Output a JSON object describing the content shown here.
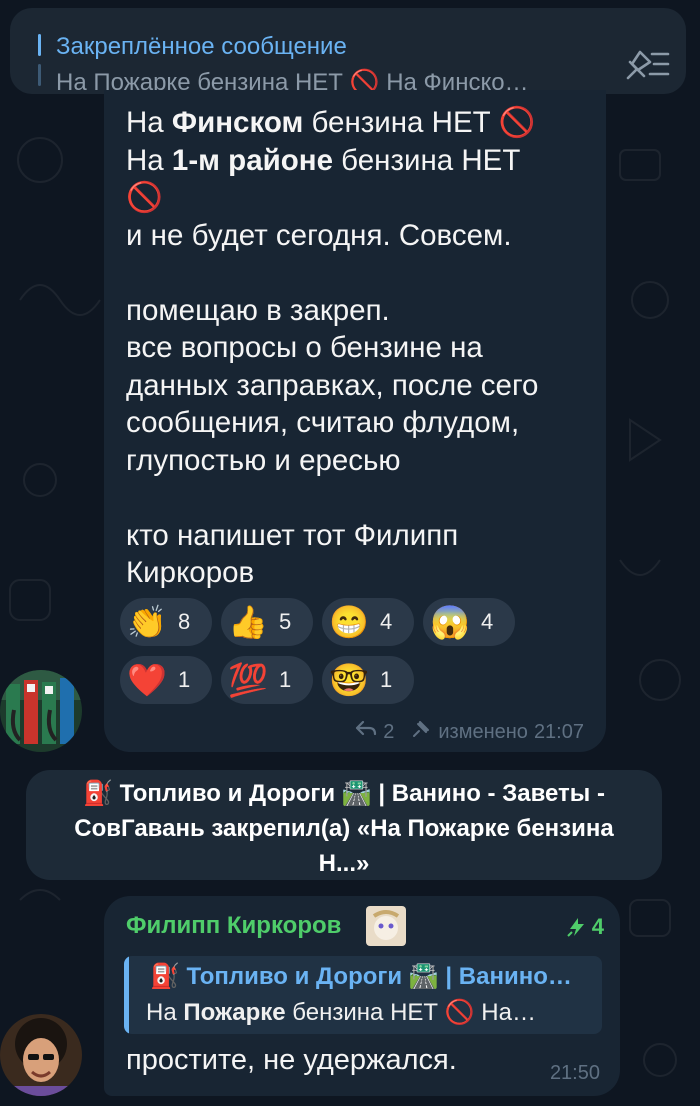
{
  "pinned": {
    "title": "Закреплённое сообщение",
    "preview": "На Пожарке бензина НЕТ 🚫  На Финско…",
    "action_icon": "pin-list-icon"
  },
  "message1": {
    "lines": [
      {
        "pre": "На ",
        "bold": "Финском",
        "post": " бензина НЕТ 🚫"
      },
      {
        "pre": "На ",
        "bold": "1-м районе",
        "post": " бензина НЕТ"
      },
      {
        "pre": "🚫",
        "bold": "",
        "post": ""
      },
      {
        "pre": "и не будет сегодня. Совсем.",
        "bold": "",
        "post": ""
      },
      {
        "pre": "",
        "bold": "",
        "post": ""
      },
      {
        "pre": "помещаю в закреп.",
        "bold": "",
        "post": ""
      },
      {
        "pre": "все вопросы о бензине на",
        "bold": "",
        "post": ""
      },
      {
        "pre": "данных заправках, после сего",
        "bold": "",
        "post": ""
      },
      {
        "pre": "сообщения, считаю флудом,",
        "bold": "",
        "post": ""
      },
      {
        "pre": "глупостью и ересью",
        "bold": "",
        "post": ""
      },
      {
        "pre": "",
        "bold": "",
        "post": ""
      },
      {
        "pre": "кто напишет тот Филипп",
        "bold": "",
        "post": ""
      },
      {
        "pre": "Киркоров",
        "bold": "",
        "post": ""
      }
    ],
    "reactions": [
      {
        "emoji": "👏",
        "count": "8"
      },
      {
        "emoji": "👍",
        "count": "5"
      },
      {
        "emoji": "😁",
        "count": "4"
      },
      {
        "emoji": "😱",
        "count": "4"
      },
      {
        "emoji": "❤️",
        "count": "1"
      },
      {
        "emoji": "💯",
        "count": "1"
      },
      {
        "emoji": "🤓",
        "count": "1"
      }
    ],
    "replies": "2",
    "edited_label": "изменено",
    "time": "21:07"
  },
  "service": {
    "line1": "⛽ Топливо и Дороги 🛣️ | Ванино - Заветы -",
    "line2": "СовГавань закрепил(а) «На Пожарке бензина",
    "line3": "Н...»"
  },
  "message2": {
    "sender": "Филипп Киркоров",
    "boosts": "4",
    "quote_title": "⛽ Топливо и Дороги 🛣️ | Ванино…",
    "quote_pre": "На ",
    "quote_bold": "Пожарке",
    "quote_post": " бензина НЕТ 🚫  На…",
    "text": "простите, не удержался.",
    "time": "21:50"
  },
  "colors": {
    "background": "#0e1621",
    "bubble": "#182533",
    "accent": "#6ab3f3",
    "sender": "#4fcd6a",
    "muted": "#5f7082"
  }
}
